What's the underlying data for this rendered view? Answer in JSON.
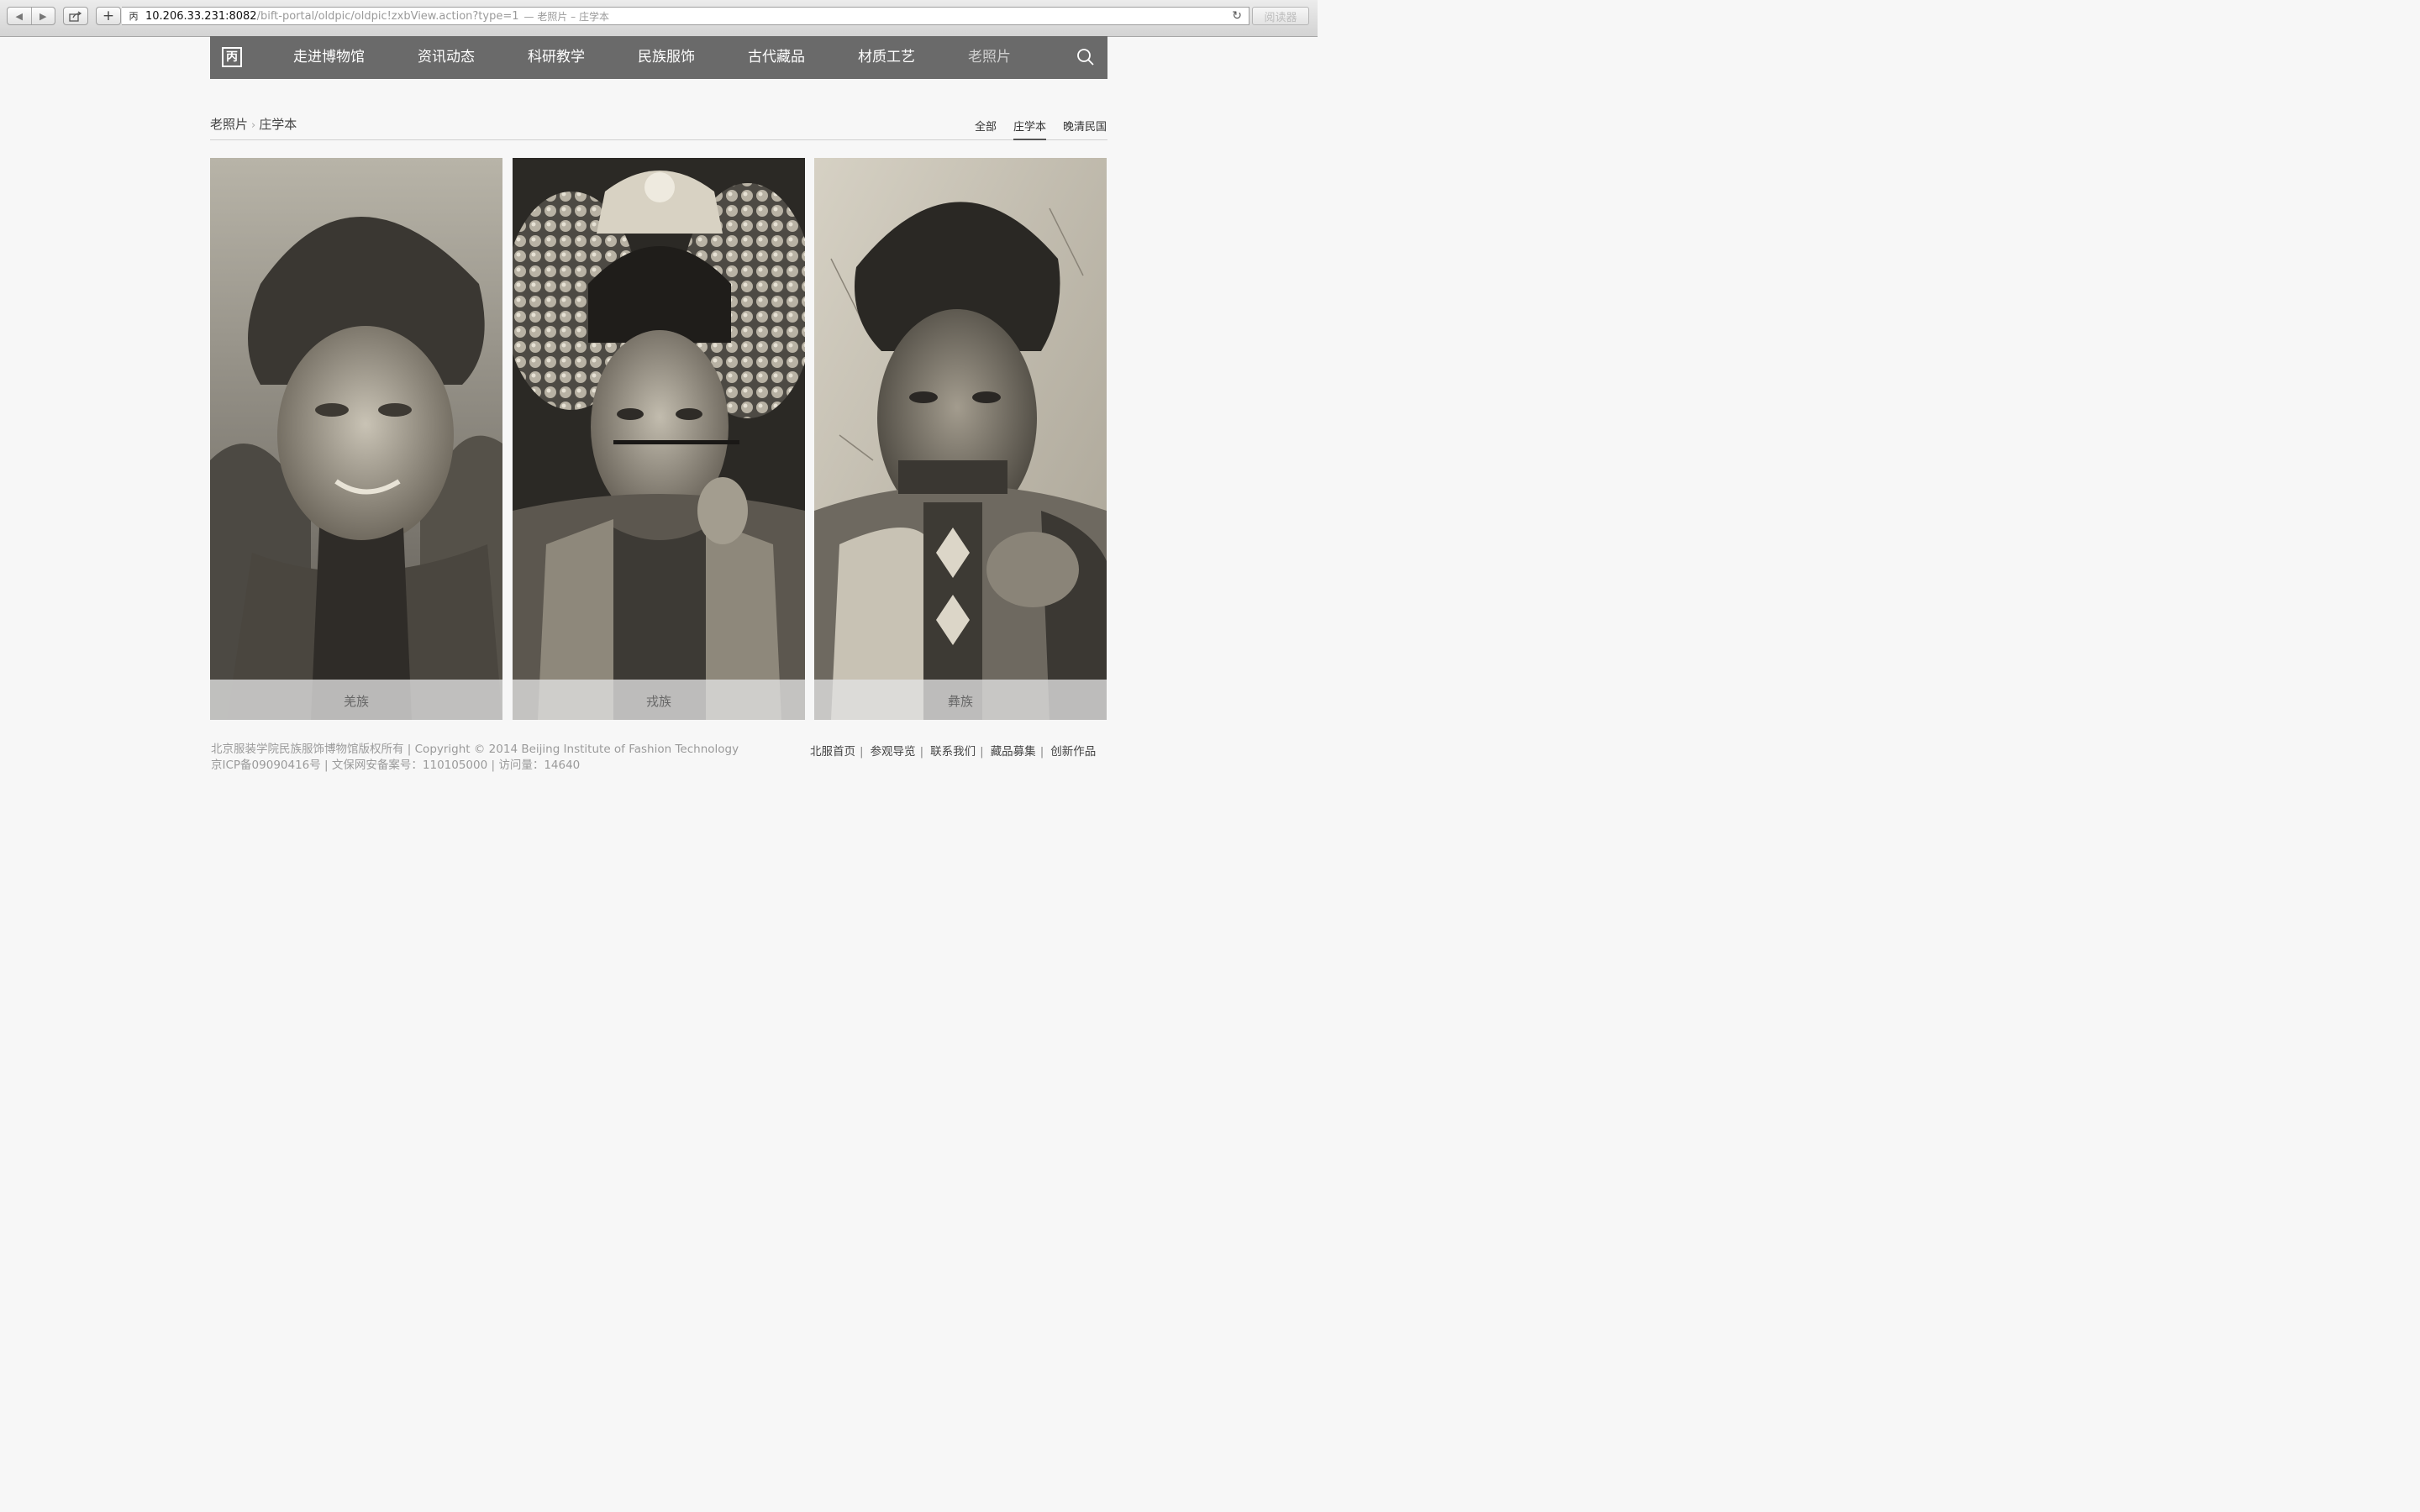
{
  "browser": {
    "url_host": "10.206.33.231:8082",
    "url_path": "/bift-portal/oldpic/oldpic!zxbView.action?type=1",
    "tab_title": "— 老照片 – 庄学本",
    "reader_label": "阅读器",
    "favicon_glyph": "丙"
  },
  "nav": {
    "logo_glyph": "丙",
    "items": [
      "走进博物馆",
      "资讯动态",
      "科研教学",
      "民族服饰",
      "古代藏品",
      "材质工艺",
      "老照片"
    ],
    "active_item": "老照片"
  },
  "breadcrumb": {
    "parent": "老照片",
    "separator": "›",
    "current": "庄学本"
  },
  "filters": [
    "全部",
    "庄学本",
    "晚清民国"
  ],
  "active_filter": "庄学本",
  "photos": [
    {
      "caption": "羌族",
      "icon": "portrait-photo"
    },
    {
      "caption": "戎族",
      "icon": "portrait-photo"
    },
    {
      "caption": "彝族",
      "icon": "portrait-photo"
    }
  ],
  "footer": {
    "line1": "北京服装学院民族服饰博物馆版权所有 | Copyright © 2014 Beijing Institute of Fashion Technology",
    "line2": "京ICP备09090416号 | 文保网安备案号：110105000 | 访问量：14640",
    "links": [
      "北服首页",
      "参观导览",
      "联系我们",
      "藏品募集",
      "创新作品"
    ]
  },
  "colors": {
    "nav_bg": "#6a6a6a",
    "page_bg": "#f7f7f7",
    "caption_bg": "#e1e1e1"
  }
}
